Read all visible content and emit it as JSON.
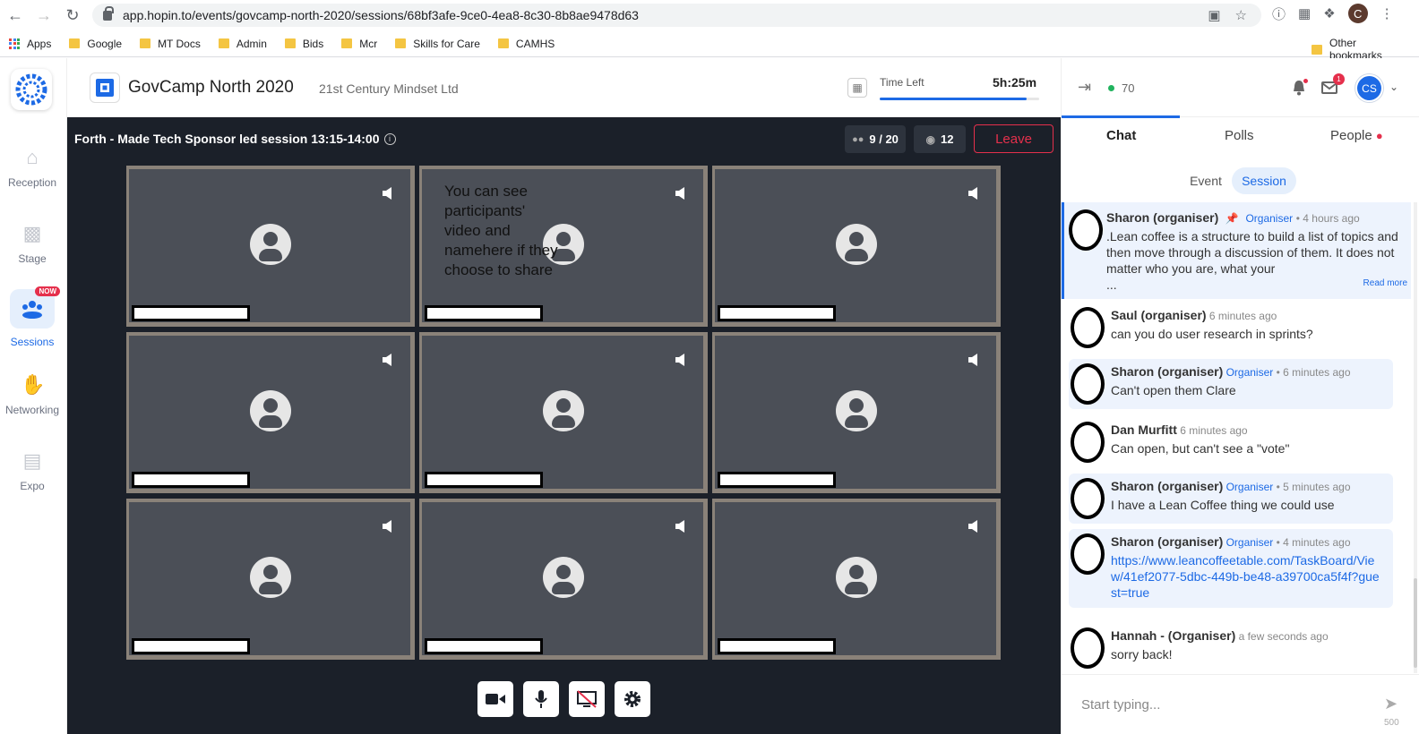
{
  "browser": {
    "url": "app.hopin.to/events/govcamp-north-2020/sessions/68bf3afe-9ce0-4ea8-8c30-8b8ae9478d63",
    "profile_initial": "C",
    "bookmarks": [
      "Apps",
      "Google",
      "MT Docs",
      "Admin",
      "Bids",
      "Mcr",
      "Skills for Care",
      "CAMHS"
    ],
    "other_bookmarks": "Other bookmarks"
  },
  "sidebar": {
    "items": [
      {
        "label": "Reception",
        "icon": "home-icon"
      },
      {
        "label": "Stage",
        "icon": "video-camera-icon"
      },
      {
        "label": "Sessions",
        "icon": "sessions-icon",
        "badge": "NOW"
      },
      {
        "label": "Networking",
        "icon": "handshake-icon"
      },
      {
        "label": "Expo",
        "icon": "store-icon"
      }
    ],
    "accent": "#1d6ae5"
  },
  "header": {
    "event_name": "GovCamp North 2020",
    "organizer": "21st Century Mindset Ltd",
    "time_left_label": "Time Left",
    "time_left_value": "5h:25m",
    "time_progress": 0.92
  },
  "session": {
    "title": "Forth - Made Tech Sponsor led session 13:15-14:00",
    "participants": "9 / 20",
    "viewers": "12",
    "leave_label": "Leave",
    "tile_note": "You can see participants' video  and namehere if they choose to share"
  },
  "panel": {
    "online_count": "70",
    "mail_badge": "1",
    "user_initials": "CS",
    "tabs": [
      "Chat",
      "Polls",
      "People"
    ],
    "subtabs": [
      "Event",
      "Session"
    ],
    "pinned": {
      "name": "Sharon (organiser)",
      "role": "Organiser",
      "time": "• 4 hours ago",
      "text": ".Lean coffee is a structure to build a list of topics and then move through a discussion of them. It does not matter who you are, what your",
      "ellipsis": "...",
      "read_more": "Read more"
    },
    "messages": [
      {
        "name": "Saul (organiser)",
        "role": "",
        "time": "6 minutes ago",
        "text": "can you do user research in sprints?"
      },
      {
        "name": "Sharon (organiser)",
        "role": "Organiser",
        "time": "• 6 minutes ago",
        "text": "Can't open them Clare"
      },
      {
        "name": "Dan Murfitt",
        "role": "",
        "time": "6 minutes ago",
        "text": "Can open, but can't see a \"vote\""
      },
      {
        "name": "Sharon (organiser)",
        "role": "Organiser",
        "time": "• 5 minutes ago",
        "text": "I have a Lean Coffee thing we could use"
      },
      {
        "name": "Sharon (organiser)",
        "role": "Organiser",
        "time": "• 4 minutes ago",
        "text": "https://www.leancoffeetable.com/TaskBoard/View/41ef2077-5dbc-449b-be48-a39700ca5f4f?guest=true"
      },
      {
        "name": "Hannah - (Organiser)",
        "role": "",
        "time": "a few seconds ago",
        "text": "sorry back!"
      }
    ],
    "composer_placeholder": "Start typing...",
    "char_limit": "500"
  }
}
